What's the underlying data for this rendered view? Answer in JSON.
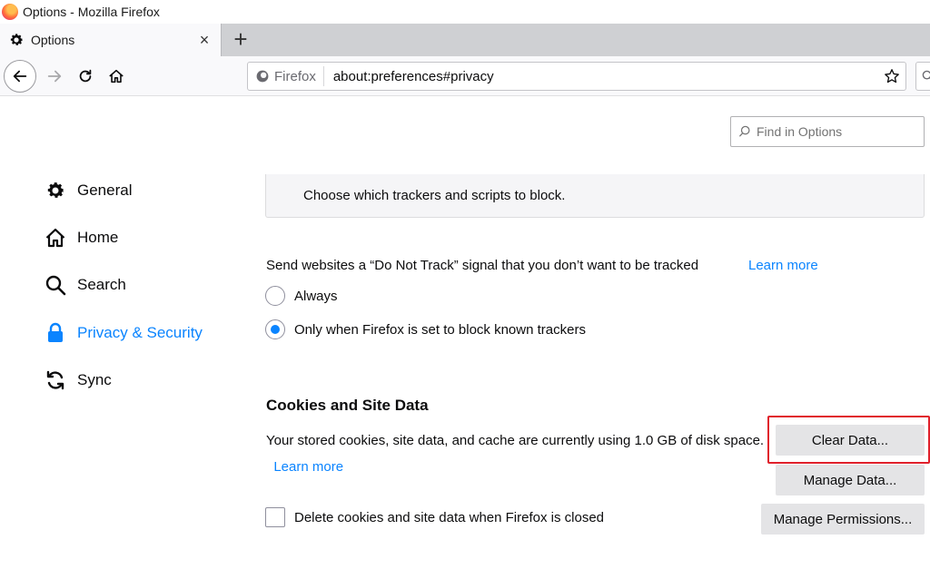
{
  "window": {
    "title": "Options - Mozilla Firefox"
  },
  "tabs": [
    {
      "label": "Options",
      "icon": "gear-icon",
      "close": "×"
    }
  ],
  "newtab_symbol": "+",
  "urlbar": {
    "identity_label": "Firefox",
    "url": "about:preferences#privacy"
  },
  "find": {
    "placeholder": "Find in Options"
  },
  "categories": [
    {
      "label": "General",
      "icon": "gear-icon",
      "selected": false
    },
    {
      "label": "Home",
      "icon": "home-icon",
      "selected": false
    },
    {
      "label": "Search",
      "icon": "search-icon",
      "selected": false
    },
    {
      "label": "Privacy & Security",
      "icon": "lock-icon",
      "selected": true
    },
    {
      "label": "Sync",
      "icon": "sync-icon",
      "selected": false
    }
  ],
  "tracking": {
    "panel_text": "Choose which trackers and scripts to block."
  },
  "dnt": {
    "text": "Send websites a “Do Not Track” signal that you don’t want to be tracked",
    "learn_more": "Learn more",
    "options": [
      {
        "label": "Always",
        "checked": false
      },
      {
        "label": "Only when Firefox is set to block known trackers",
        "checked": true
      }
    ]
  },
  "cookies": {
    "heading": "Cookies and Site Data",
    "description": "Your stored cookies, site data, and cache are currently using 1.0 GB of disk space.",
    "learn_more": "Learn more",
    "clear_button": "Clear Data...",
    "manage_button": "Manage Data...",
    "permissions_button": "Manage Permissions...",
    "delete_on_close_label": "Delete cookies and site data when Firefox is closed",
    "delete_on_close_checked": false
  },
  "colors": {
    "accent": "#0a84ff",
    "highlight": "#e0202b",
    "button": "#e4e4e6"
  }
}
